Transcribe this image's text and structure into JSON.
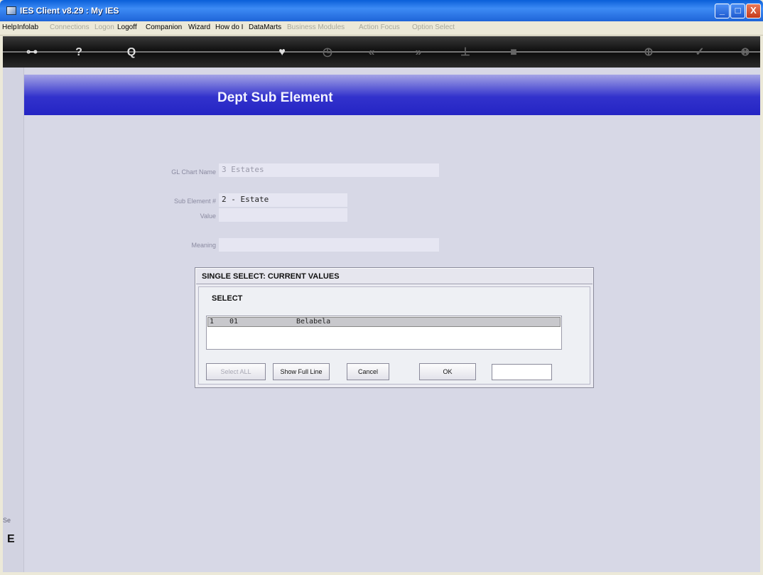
{
  "window": {
    "title": "IES Client v8.29 : My IES",
    "min": "_",
    "max": "□",
    "close": "X"
  },
  "menu": [
    {
      "label": "Help",
      "enabled": true
    },
    {
      "label": "Infolab",
      "enabled": true
    },
    {
      "label": "Connections",
      "enabled": false
    },
    {
      "label": "Logon",
      "enabled": false
    },
    {
      "label": "Logoff",
      "enabled": true
    },
    {
      "label": "Companion",
      "enabled": true
    },
    {
      "label": "Wizard",
      "enabled": true
    },
    {
      "label": "How do I",
      "enabled": true
    },
    {
      "label": "DataMarts",
      "enabled": true
    },
    {
      "label": "Business Modules",
      "enabled": false
    },
    {
      "label": "Action Focus",
      "enabled": false
    },
    {
      "label": "Option Select",
      "enabled": false
    }
  ],
  "toolbar": {
    "icons": [
      "key-icon",
      "help-icon",
      "search-icon",
      "heart-icon",
      "clock-icon",
      "back-icon",
      "forward-icon",
      "filter-icon",
      "stop-icon",
      "cancel-icon",
      "ok-icon",
      "close-icon"
    ],
    "glyphs": [
      "⊶",
      "?",
      "Q",
      "♥",
      "◷",
      "«",
      "»",
      "⊥",
      "■",
      "⊕",
      "✓",
      "⊗"
    ]
  },
  "page": {
    "title": "Dept Sub Element"
  },
  "form": {
    "gl_chart_name": {
      "label": "GL Chart Name",
      "value": "3 Estates"
    },
    "sub_element": {
      "label": "Sub Element #",
      "value": "2 - Estate"
    },
    "value": {
      "label": "Value",
      "value": ""
    },
    "meaning": {
      "label": "Meaning",
      "value": ""
    }
  },
  "dialog": {
    "title": "SINGLE SELECT: CURRENT VALUES",
    "header": "SELECT",
    "rows": [
      {
        "index": "1",
        "code": "01",
        "name": "Belabela"
      }
    ],
    "buttons": {
      "select_all": "Select ALL",
      "show_full_line": "Show Full Line",
      "cancel": "Cancel",
      "ok": "OK"
    },
    "search_value": ""
  },
  "left_strip": {
    "label": "Se",
    "glyph": "E"
  }
}
